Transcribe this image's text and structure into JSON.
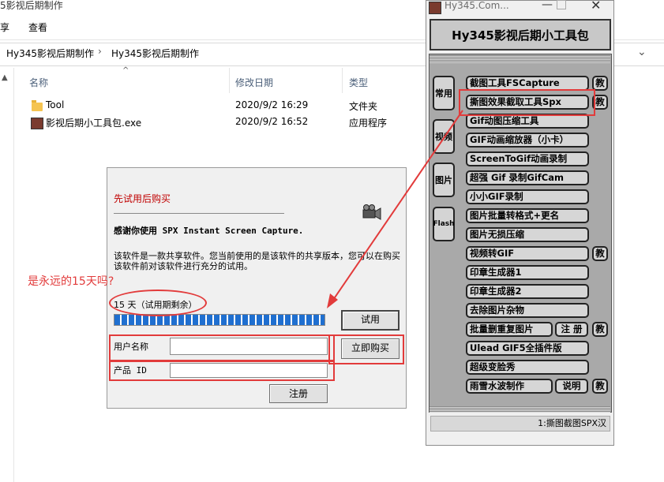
{
  "explorer": {
    "title": "5影视后期制作",
    "ribbon": {
      "share": "享",
      "view": "查看"
    },
    "breadcrumb": {
      "part1": "Hy345影视后期制作",
      "separator": "›",
      "part2": "Hy345影视后期制作"
    },
    "columns": {
      "name": "名称",
      "modified": "修改日期",
      "type": "类型"
    },
    "files": [
      {
        "name": "Tool",
        "date": "2020/9/2 16:29",
        "type": "文件夹"
      },
      {
        "name": "影视后期小工具包.exe",
        "date": "2020/9/2 16:52",
        "type": "应用程序"
      }
    ]
  },
  "dialog": {
    "heading": "先试用后购买",
    "thanks": "感谢你使用 SPX Instant Screen Capture.",
    "description": "该软件是一款共享软件。您当前使用的是该软件的共享版本，您可以在购买该软件前对该软件进行充分的试用。",
    "days_left": "15 天（试用期剩余）",
    "progress_fraction": 1.0,
    "trial_button": "试用",
    "buy_button": "立即购买",
    "register_button": "注册",
    "username_label": "用户名称",
    "username_value": "",
    "productid_label": "产品 ID",
    "productid_value": ""
  },
  "annotation": {
    "question": "是永远的15天吗?",
    "color": "#e23b3b"
  },
  "toolbox": {
    "title": "Hy345.Com...",
    "header": "Hy345影视后期小工具包",
    "categories": [
      "常用",
      "视频",
      "图片",
      "Flash"
    ],
    "tools": [
      "截图工具FSCapture",
      "撕图效果截取工具Spx",
      "Gif动图压缩工具",
      "GIF动画缩放器（小卡）",
      "ScreenToGif动画录制",
      "超强 Gif 录制GifCam",
      "小小GIF录制",
      "图片批量转格式+更名",
      "图片无损压缩",
      "视频转GIF",
      "印章生成器1",
      "印章生成器2",
      "去除图片杂物",
      "批量删重复图片",
      "Ulead GIF5全插件版",
      "超级变脸秀",
      "雨雪水波制作"
    ],
    "side_teach": "教",
    "side_register": "注 册",
    "side_explain": "说明",
    "status": "1:撕图截图SPX汉"
  }
}
